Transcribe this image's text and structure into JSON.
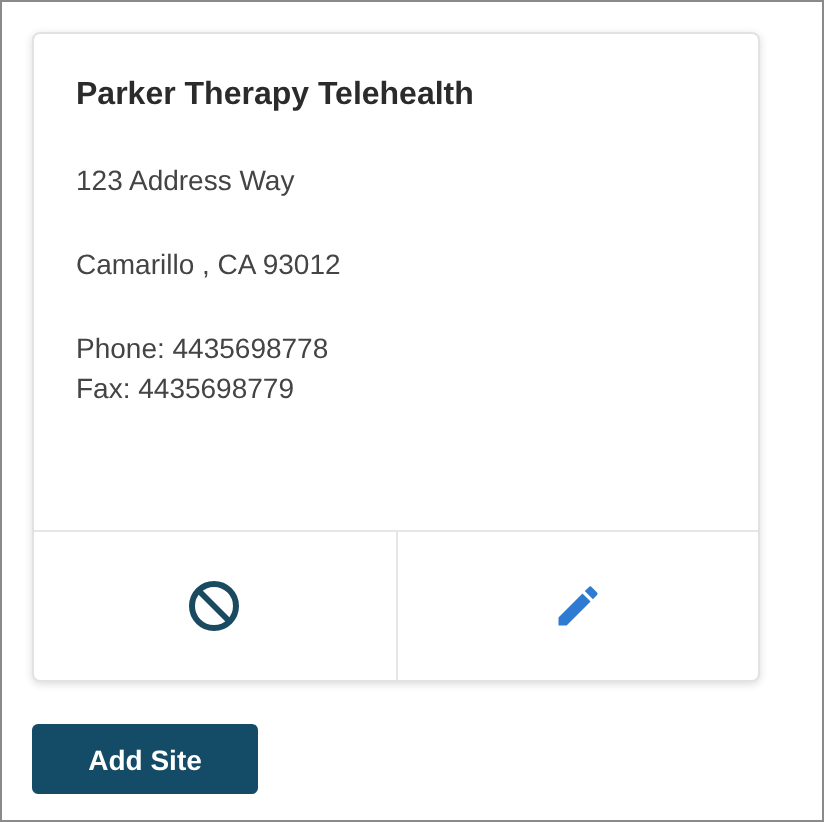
{
  "site_card": {
    "name": "Parker Therapy Telehealth",
    "address_line_1": "123 Address Way",
    "address_line_2": "Camarillo , CA 93012",
    "phone": "Phone: 4435698778",
    "fax": "Fax: 4435698779"
  },
  "add_button": {
    "label": "Add Site"
  }
}
